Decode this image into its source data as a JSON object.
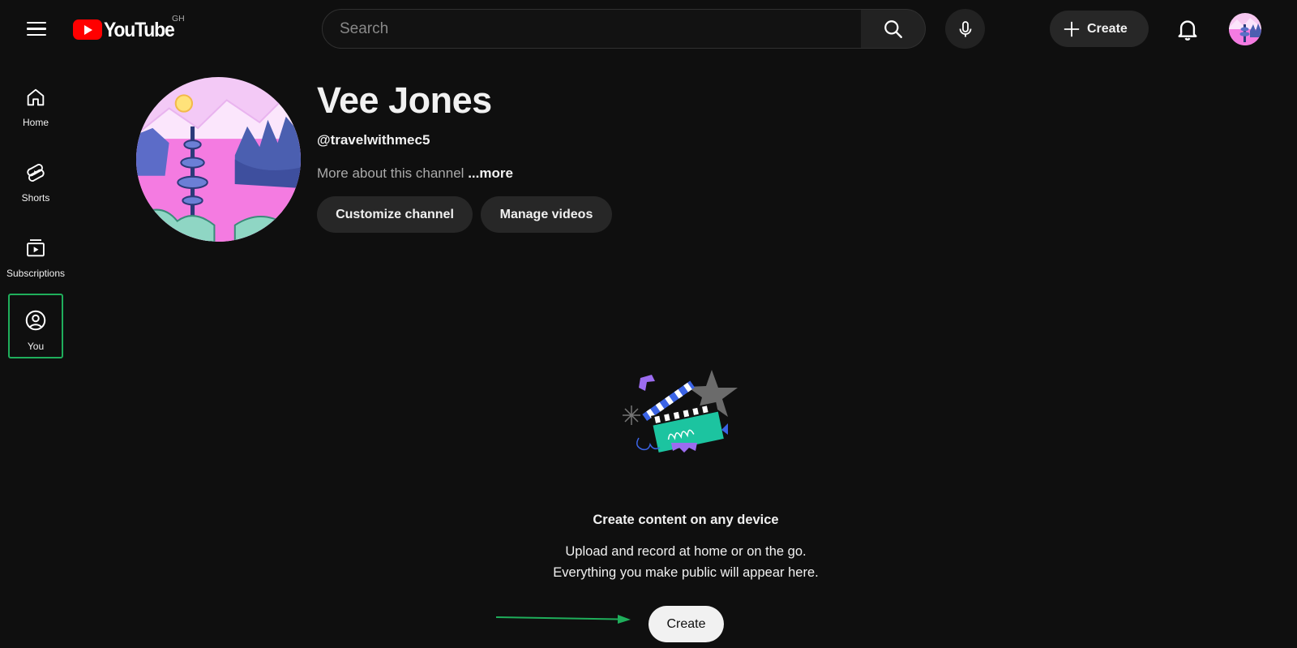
{
  "header": {
    "menu_icon": "hamburger-menu-icon",
    "logo_text": "YouTube",
    "logo_region": "GH",
    "search_placeholder": "Search",
    "create_label": "Create",
    "bell_icon": "bell-icon",
    "accent_color": "#ff0000"
  },
  "sidebar": {
    "items": [
      {
        "label": "Home",
        "icon": "home-icon"
      },
      {
        "label": "Shorts",
        "icon": "shorts-icon"
      },
      {
        "label": "Subscriptions",
        "icon": "subscriptions-icon"
      },
      {
        "label": "You",
        "icon": "user-circle-icon",
        "highlighted": true
      }
    ]
  },
  "channel": {
    "name": "Vee Jones",
    "handle": "@travelwithmec5",
    "about_text": "More about this channel",
    "more_label": "...more",
    "customize_label": "Customize channel",
    "manage_label": "Manage videos"
  },
  "empty_state": {
    "title": "Create content on any device",
    "line1": "Upload and record at home or on the go.",
    "line2": "Everything you make public will appear here.",
    "create_label": "Create",
    "annotation_color": "#1fae5b"
  }
}
